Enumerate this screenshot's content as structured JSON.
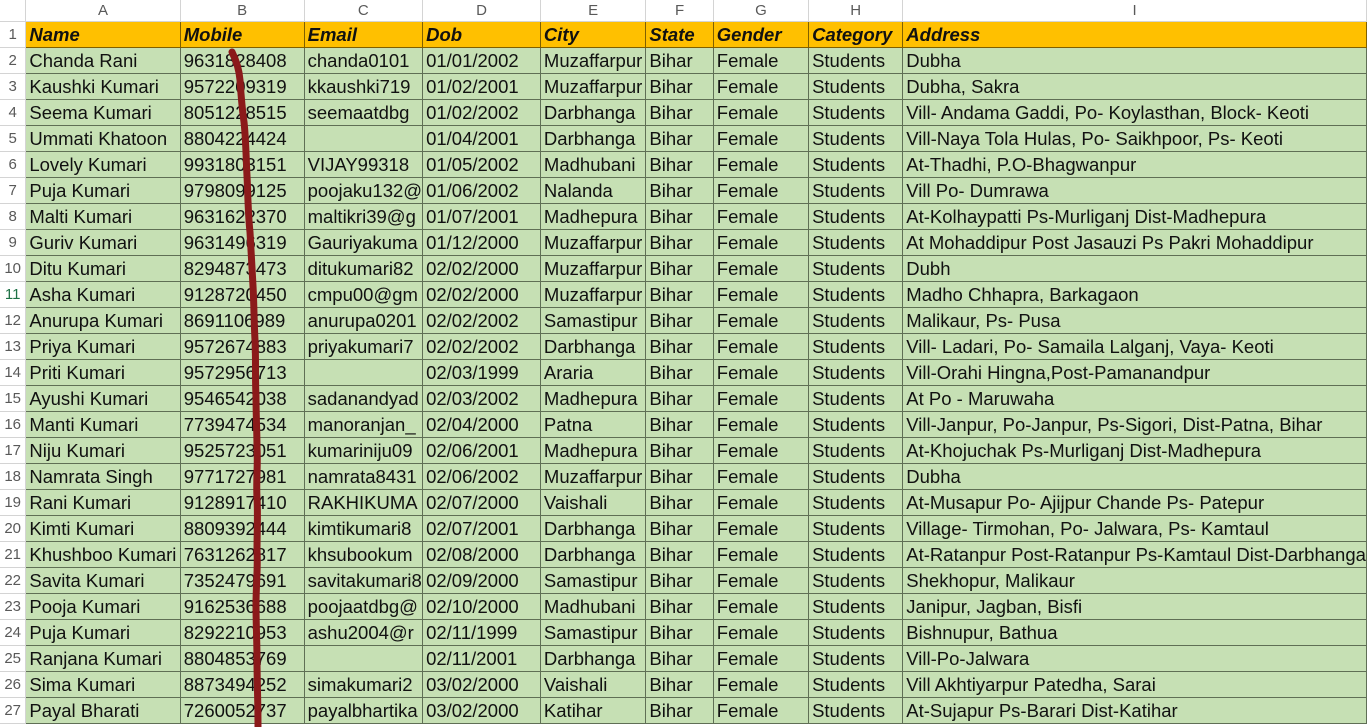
{
  "columns": [
    "A",
    "B",
    "C",
    "D",
    "E",
    "F",
    "G",
    "H",
    "I"
  ],
  "header": [
    "Name",
    "Mobile",
    "Email",
    "Dob",
    "City",
    "State",
    "Gender",
    "Category",
    "Address"
  ],
  "rows": [
    [
      "Chanda Rani",
      "9631828408",
      "chanda0101",
      "01/01/2002",
      "Muzaffarpur",
      "Bihar",
      "Female",
      "Students",
      "Dubha"
    ],
    [
      "Kaushki Kumari",
      "9572209319",
      "kkaushki719",
      "01/02/2001",
      "Muzaffarpur",
      "Bihar",
      "Female",
      "Students",
      "Dubha, Sakra"
    ],
    [
      "Seema Kumari",
      "8051228515",
      "seemaatdbg",
      "01/02/2002",
      "Darbhanga",
      "Bihar",
      "Female",
      "Students",
      "Vill- Andama Gaddi, Po- Koylasthan, Block- Keoti"
    ],
    [
      "Ummati Khatoon",
      "8804224424",
      "",
      "01/04/2001",
      "Darbhanga",
      "Bihar",
      "Female",
      "Students",
      "Vill-Naya Tola Hulas, Po- Saikhpoor, Ps- Keoti"
    ],
    [
      "Lovely Kumari",
      "9931803151",
      "VIJAY99318",
      "01/05/2002",
      "Madhubani",
      "Bihar",
      "Female",
      "Students",
      "At-Thadhi, P.O-Bhagwanpur"
    ],
    [
      "Puja Kumari",
      "9798099125",
      "poojaku132@",
      "01/06/2002",
      "Nalanda",
      "Bihar",
      "Female",
      "Students",
      "Vill Po- Dumrawa"
    ],
    [
      "Malti Kumari",
      "9631622370",
      "maltikri39@g",
      "01/07/2001",
      "Madhepura",
      "Bihar",
      "Female",
      "Students",
      "At-Kolhaypatti Ps-Murliganj Dist-Madhepura"
    ],
    [
      "Guriv Kumari",
      "9631496319",
      "Gauriyakuma",
      "01/12/2000",
      "Muzaffarpur",
      "Bihar",
      "Female",
      "Students",
      "At Mohaddipur Post Jasauzi Ps Pakri Mohaddipur"
    ],
    [
      "Ditu Kumari",
      "8294873473",
      "ditukumari82",
      "02/02/2000",
      "Muzaffarpur",
      "Bihar",
      "Female",
      "Students",
      "Dubh"
    ],
    [
      "Asha Kumari",
      "9128720450",
      "cmpu00@gm",
      "02/02/2000",
      "Muzaffarpur",
      "Bihar",
      "Female",
      "Students",
      "Madho Chhapra, Barkagaon"
    ],
    [
      "Anurupa Kumari",
      "8691106989",
      "anurupa0201",
      "02/02/2002",
      "Samastipur",
      "Bihar",
      "Female",
      "Students",
      "Malikaur, Ps- Pusa"
    ],
    [
      "Priya Kumari",
      "9572674883",
      "priyakumari7",
      "02/02/2002",
      "Darbhanga",
      "Bihar",
      "Female",
      "Students",
      "Vill- Ladari, Po- Samaila Lalganj, Vaya- Keoti"
    ],
    [
      "Priti Kumari",
      "9572956713",
      "",
      "02/03/1999",
      "Araria",
      "Bihar",
      "Female",
      "Students",
      "Vill-Orahi Hingna,Post-Pamanandpur"
    ],
    [
      "Ayushi Kumari",
      "9546542038",
      "sadanandyad",
      "02/03/2002",
      "Madhepura",
      "Bihar",
      "Female",
      "Students",
      "At Po - Maruwaha"
    ],
    [
      "Manti Kumari",
      "7739474534",
      "manoranjan_",
      "02/04/2000",
      "Patna",
      "Bihar",
      "Female",
      "Students",
      "Vill-Janpur, Po-Janpur, Ps-Sigori, Dist-Patna, Bihar"
    ],
    [
      "Niju Kumari",
      "9525723051",
      "kumariniju09",
      "02/06/2001",
      "Madhepura",
      "Bihar",
      "Female",
      "Students",
      "At-Khojuchak Ps-Murliganj Dist-Madhepura"
    ],
    [
      "Namrata Singh",
      "9771727981",
      "namrata8431",
      "02/06/2002",
      "Muzaffarpur",
      "Bihar",
      "Female",
      "Students",
      "Dubha"
    ],
    [
      "Rani Kumari",
      "9128917410",
      "RAKHIKUMA",
      "02/07/2000",
      "Vaishali",
      "Bihar",
      "Female",
      "Students",
      "At-Musapur  Po- Ajijpur Chande Ps- Patepur"
    ],
    [
      "Kimti Kumari",
      "8809392444",
      "kimtikumari8",
      "02/07/2001",
      "Darbhanga",
      "Bihar",
      "Female",
      "Students",
      "Village- Tirmohan, Po- Jalwara, Ps- Kamtaul"
    ],
    [
      "Khushboo Kumari",
      "7631262817",
      "khsubookum",
      "02/08/2000",
      "Darbhanga",
      "Bihar",
      "Female",
      "Students",
      "At-Ratanpur Post-Ratanpur Ps-Kamtaul Dist-Darbhanga"
    ],
    [
      "Savita Kumari",
      "7352479691",
      "savitakumari8",
      "02/09/2000",
      "Samastipur",
      "Bihar",
      "Female",
      "Students",
      "Shekhopur, Malikaur"
    ],
    [
      "Pooja Kumari",
      "9162536688",
      "poojaatdbg@",
      "02/10/2000",
      "Madhubani",
      "Bihar",
      "Female",
      "Students",
      "Janipur, Jagban, Bisfi"
    ],
    [
      "Puja Kumari",
      "8292210953",
      "ashu2004@r",
      "02/11/1999",
      "Samastipur",
      "Bihar",
      "Female",
      "Students",
      "Bishnupur, Bathua"
    ],
    [
      "Ranjana Kumari",
      "8804853769",
      "",
      "02/11/2001",
      "Darbhanga",
      "Bihar",
      "Female",
      "Students",
      "Vill-Po-Jalwara"
    ],
    [
      "Sima Kumari",
      "8873494252",
      "simakumari2",
      "03/02/2000",
      "Vaishali",
      "Bihar",
      "Female",
      "Students",
      "Vill Akhtiyarpur Patedha, Sarai"
    ],
    [
      "Payal Bharati",
      "7260052737",
      "payalbhartika",
      "03/02/2000",
      "Katihar",
      "Bihar",
      "Female",
      "Students",
      "At-Sujapur Ps-Barari Dist-Katihar"
    ]
  ],
  "colors": {
    "header_fill": "#ffc000",
    "data_fill": "#c6e0b4",
    "scribble": "#8b1a1a"
  }
}
